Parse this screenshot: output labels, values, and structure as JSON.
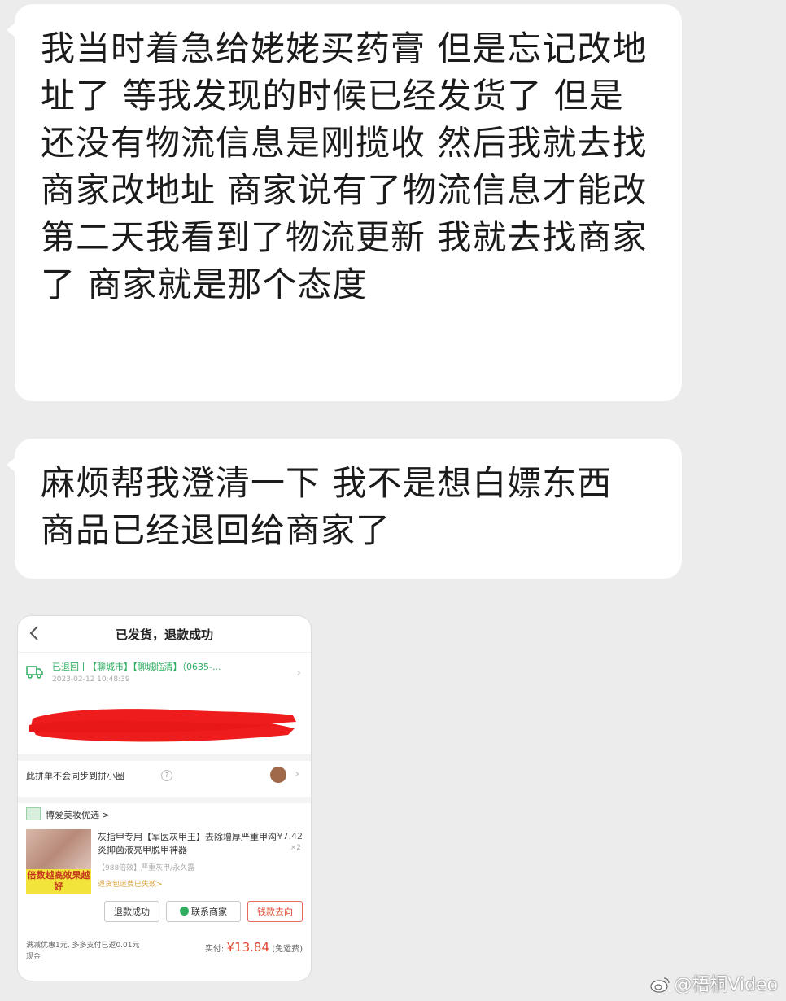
{
  "messages": [
    {
      "text": "我当时着急给姥姥买药膏 但是忘记改地址了 等我发现的时候已经发货了 但是还没有物流信息是刚揽收 然后我就去找商家改地址 商家说有了物流信息才能改 第二天我看到了物流更新 我就去找商家了 商家就是那个态度"
    },
    {
      "text": "麻烦帮我澄清一下 我不是想白嫖东西 商品已经退回给商家了"
    }
  ],
  "order_screenshot": {
    "title": "已发货，退款成功",
    "logistics": {
      "status": "已退回丨【聊城市】【聊城临清】（0635-...",
      "time": "2023-02-12 10:48:39"
    },
    "pin_notice": "此拼单不会同步到拼小圈",
    "store_name": "博爱美妆优选 >",
    "product": {
      "name": "灰指甲专用【军医灰甲王】去除增厚严重甲沟炎抑菌液亮甲脱甲神器",
      "price": "¥7.42",
      "qty": "×2",
      "spec": "【988倍效】严重灰甲/永久露",
      "promo": "退货包运费已失效>",
      "tag": "倍数越高效果越好"
    },
    "buttons": [
      "退款成功",
      "联系商家",
      "钱款去向"
    ],
    "footer_left": "满减优惠1元, 多多支付已返0.01元现金",
    "paid_label": "实付:",
    "paid_amount": "¥13.84",
    "paid_note": "(免运费)"
  },
  "watermark": "@梧桐Video",
  "colors": {
    "background": "#ececec",
    "bubble": "#ffffff",
    "green": "#2fae62",
    "red": "#e0452e",
    "redaction": "#ee1c1c"
  }
}
